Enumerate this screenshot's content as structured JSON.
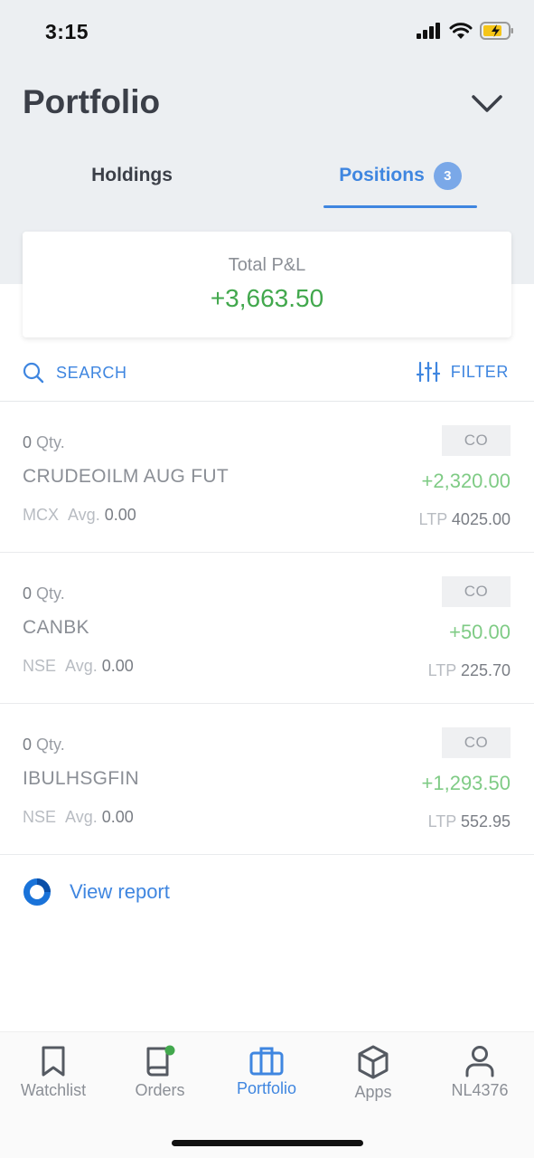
{
  "status_bar": {
    "time": "3:15"
  },
  "header": {
    "title": "Portfolio"
  },
  "tabs": [
    {
      "label": "Holdings",
      "active": false
    },
    {
      "label": "Positions",
      "active": true,
      "badge": "3"
    }
  ],
  "summary": {
    "label": "Total P&L",
    "value": "+3,663.50"
  },
  "toolbar": {
    "search_label": "SEARCH",
    "filter_label": "FILTER"
  },
  "positions": [
    {
      "qty": "0",
      "qty_unit": "Qty.",
      "symbol": "CRUDEOILM AUG FUT",
      "exchange": "MCX",
      "avg_label": "Avg.",
      "avg": "0.00",
      "type": "CO",
      "pnl": "+2,320.00",
      "ltp_label": "LTP",
      "ltp": "4025.00"
    },
    {
      "qty": "0",
      "qty_unit": "Qty.",
      "symbol": "CANBK",
      "exchange": "NSE",
      "avg_label": "Avg.",
      "avg": "0.00",
      "type": "CO",
      "pnl": "+50.00",
      "ltp_label": "LTP",
      "ltp": "225.70"
    },
    {
      "qty": "0",
      "qty_unit": "Qty.",
      "symbol": "IBULHSGFIN",
      "exchange": "NSE",
      "avg_label": "Avg.",
      "avg": "0.00",
      "type": "CO",
      "pnl": "+1,293.50",
      "ltp_label": "LTP",
      "ltp": "552.95"
    }
  ],
  "report": {
    "label": "View report"
  },
  "bottom_nav": [
    {
      "label": "Watchlist",
      "icon": "bookmark-icon"
    },
    {
      "label": "Orders",
      "icon": "book-icon"
    },
    {
      "label": "Portfolio",
      "icon": "briefcase-icon",
      "active": true
    },
    {
      "label": "Apps",
      "icon": "cube-icon"
    },
    {
      "label": "NL4376",
      "icon": "user-icon"
    }
  ],
  "colors": {
    "accent": "#3f86e0",
    "profit": "#42a84d",
    "profit_light": "#7fcb85",
    "header_bg": "#eceff2"
  }
}
